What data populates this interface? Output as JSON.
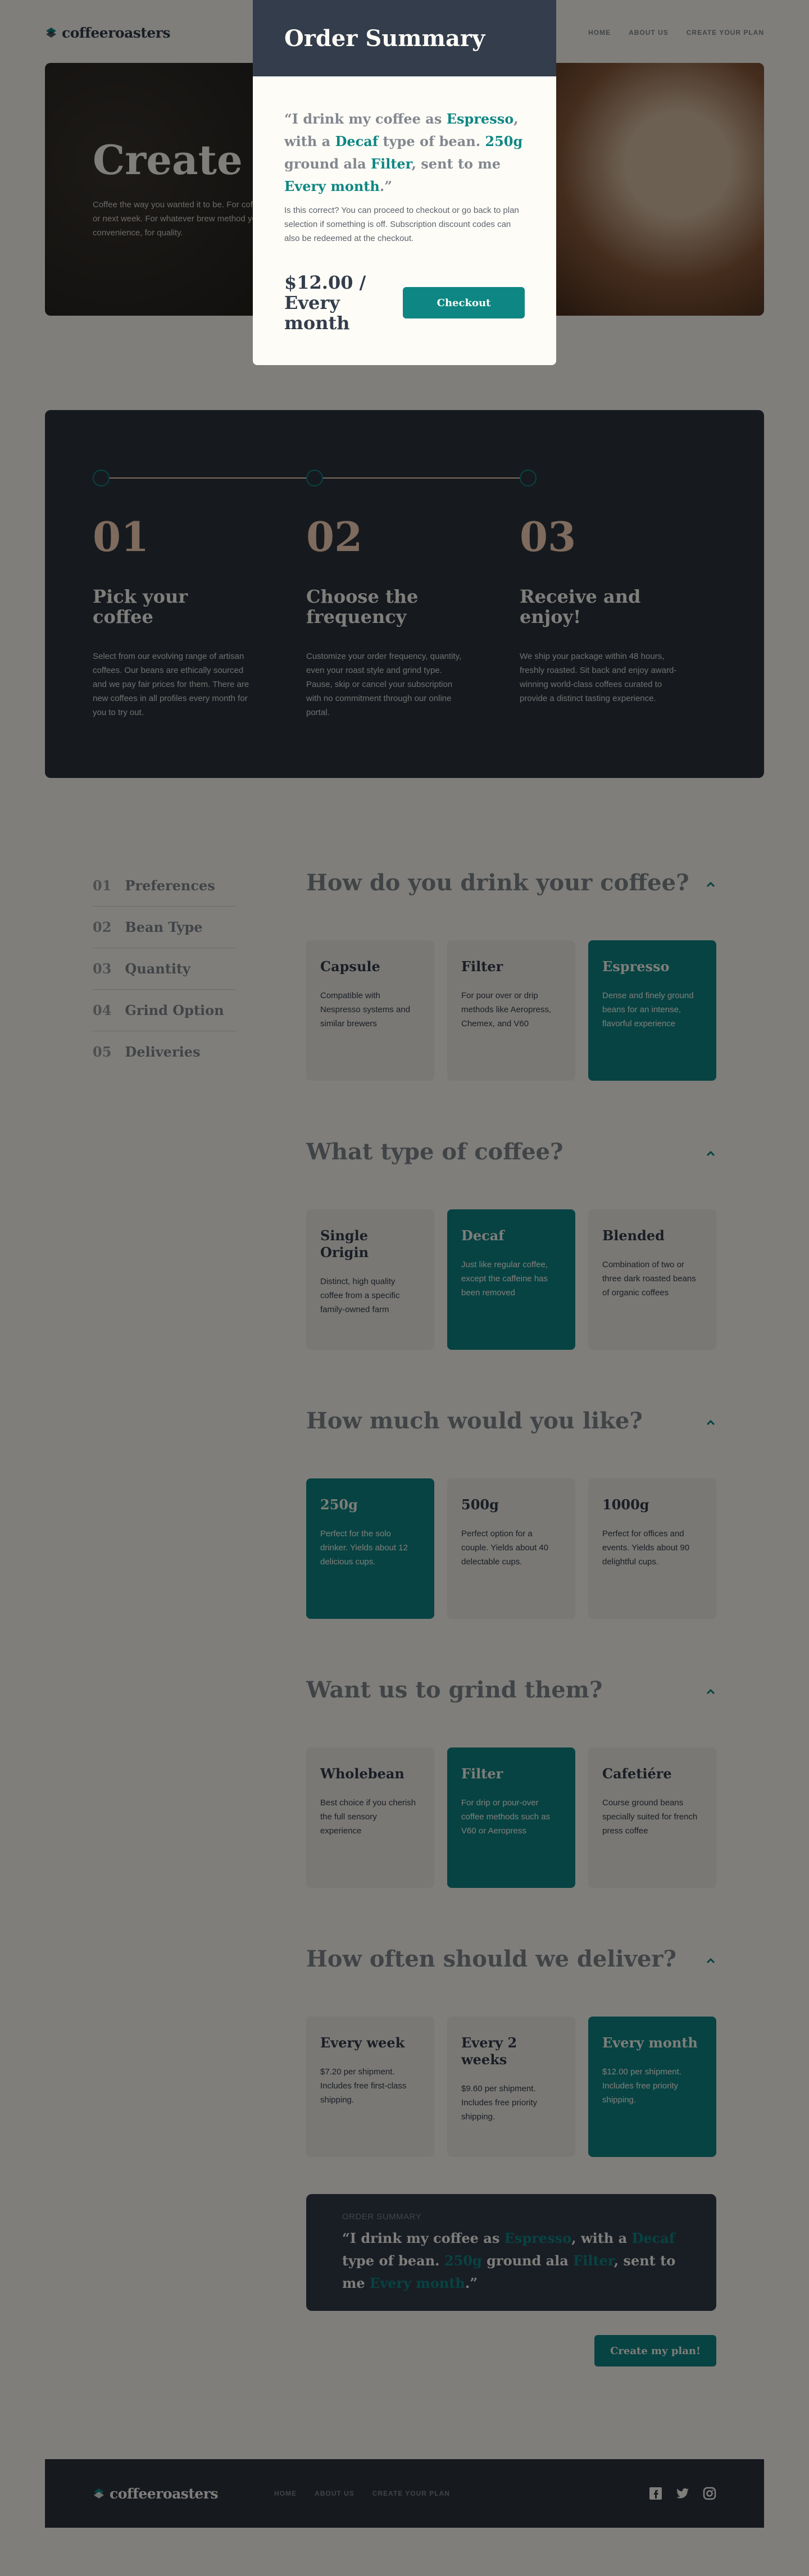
{
  "brand": {
    "name": "coffeeroasters"
  },
  "nav": [
    "Home",
    "About Us",
    "Create Your Plan"
  ],
  "hero": {
    "title": "Create plan",
    "subtitle": "Coffee the way you wanted it to be. For coffee delivered tomorrow, or next week. For whatever brew method you use. Just choice, for convenience, for quality."
  },
  "steps": [
    {
      "num": "01",
      "title": "Pick your coffee",
      "text": "Select from our evolving range of artisan coffees. Our beans are ethically sourced and we pay fair prices for them. There are new coffees in all profiles every month for you to try out."
    },
    {
      "num": "02",
      "title": "Choose the frequency",
      "text": "Customize your order frequency, quantity, even your roast style and grind type. Pause, skip or cancel your subscription with no commitment through our online portal."
    },
    {
      "num": "03",
      "title": "Receive and enjoy!",
      "text": "We ship your package within 48 hours, freshly roasted. Sit back and enjoy award-winning world-class coffees curated to provide a distinct tasting experience."
    }
  ],
  "sidenav": [
    {
      "num": "01",
      "label": "Preferences"
    },
    {
      "num": "02",
      "label": "Bean Type"
    },
    {
      "num": "03",
      "label": "Quantity"
    },
    {
      "num": "04",
      "label": "Grind Option"
    },
    {
      "num": "05",
      "label": "Deliveries"
    }
  ],
  "questions": [
    {
      "title": "How do you drink your coffee?",
      "options": [
        {
          "title": "Capsule",
          "desc": "Compatible with Nespresso systems and similar brewers",
          "selected": false
        },
        {
          "title": "Filter",
          "desc": "For pour over or drip methods like Aeropress, Chemex, and V60",
          "selected": false
        },
        {
          "title": "Espresso",
          "desc": "Dense and finely ground beans for an intense, flavorful experience",
          "selected": true
        }
      ]
    },
    {
      "title": "What type of coffee?",
      "options": [
        {
          "title": "Single Origin",
          "desc": "Distinct, high quality coffee from a specific family-owned farm",
          "selected": false
        },
        {
          "title": "Decaf",
          "desc": "Just like regular coffee, except the caffeine has been removed",
          "selected": true
        },
        {
          "title": "Blended",
          "desc": "Combination of two or three dark roasted beans of organic coffees",
          "selected": false
        }
      ]
    },
    {
      "title": "How much would you like?",
      "options": [
        {
          "title": "250g",
          "desc": "Perfect for the solo drinker. Yields about 12 delicious cups.",
          "selected": true
        },
        {
          "title": "500g",
          "desc": "Perfect option for a couple. Yields about 40 delectable cups.",
          "selected": false
        },
        {
          "title": "1000g",
          "desc": "Perfect for offices and events. Yields about 90 delightful cups.",
          "selected": false
        }
      ]
    },
    {
      "title": "Want us to grind them?",
      "options": [
        {
          "title": "Wholebean",
          "desc": "Best choice if you cherish the full sensory experience",
          "selected": false
        },
        {
          "title": "Filter",
          "desc": "For drip or pour-over coffee methods such as V60 or Aeropress",
          "selected": true
        },
        {
          "title": "Cafetiére",
          "desc": "Course ground beans specially suited for french press coffee",
          "selected": false
        }
      ]
    },
    {
      "title": "How often should we deliver?",
      "options": [
        {
          "title": "Every week",
          "desc": "$7.20 per shipment. Includes free first-class shipping.",
          "selected": false
        },
        {
          "title": "Every 2 weeks",
          "desc": "$9.60 per shipment. Includes free priority shipping.",
          "selected": false
        },
        {
          "title": "Every month",
          "desc": "$12.00 per shipment. Includes free priority shipping.",
          "selected": true
        }
      ]
    }
  ],
  "summary": {
    "label": "Order Summary",
    "parts": [
      "“I drink my coffee as ",
      "Espresso",
      ", with a ",
      "Decaf",
      " type of bean. ",
      "250g",
      " ground ala ",
      "Filter",
      ", sent to me ",
      "Every month",
      ".”"
    ]
  },
  "create_button": "Create my plan!",
  "modal": {
    "title": "Order Summary",
    "note": "Is this correct? You can proceed to checkout or go back to plan selection if something is off. Subscription discount codes can also be redeemed at the checkout.",
    "price": "$12.00 / Every month",
    "checkout": "Checkout"
  },
  "colors": {
    "accent": "#0e8784",
    "dark": "#333d4b",
    "cream": "#fefcf7",
    "peach": "#fdd6ba",
    "grey": "#83888f"
  },
  "social_icons": [
    "facebook-icon",
    "twitter-icon",
    "instagram-icon"
  ]
}
